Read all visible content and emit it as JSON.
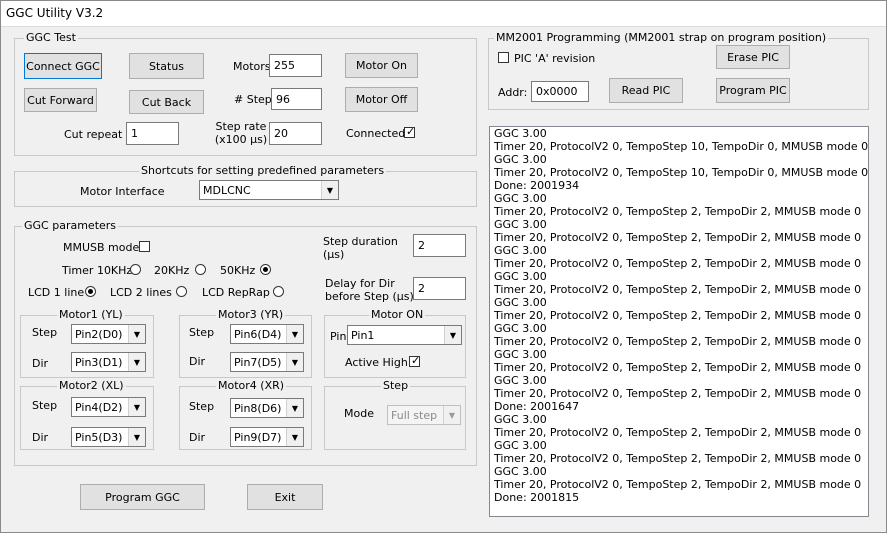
{
  "window": {
    "title": "GGC Utility V3.2"
  },
  "ggc_test": {
    "label": "GGC Test",
    "connect_ggc": "Connect GGC",
    "status": "Status",
    "cut_forward": "Cut Forward",
    "cut_back": "Cut Back",
    "cut_repeat_label": "Cut repeat",
    "cut_repeat_value": "1",
    "motors_label": "Motors",
    "motors_value": "255",
    "step_label": "# Step",
    "step_value": "96",
    "step_rate_label_1": "Step rate",
    "step_rate_label_2": "(x100 µs)",
    "step_rate_value": "20",
    "motor_on": "Motor On",
    "motor_off": "Motor Off",
    "connected_label": "Connected",
    "connected_checked": true
  },
  "shortcuts": {
    "label": "Shortcuts for setting predefined parameters",
    "motor_interface_label": "Motor Interface",
    "motor_interface_value": "MDLCNC"
  },
  "ggc_params": {
    "label": "GGC parameters",
    "mmusb_label": "MMUSB mode",
    "mmusb_checked": false,
    "timer_label": "Timer 10KHz",
    "timer_20": "20KHz",
    "timer_50": "50KHz",
    "timer_selected": "50KHz",
    "lcd_1": "LCD 1 line",
    "lcd_2": "LCD 2 lines",
    "lcd_reprap": "LCD RepRap",
    "lcd_selected": "LCD 1 line",
    "step_duration_label_1": "Step duration",
    "step_duration_label_2": "(µs)",
    "step_duration_value": "2",
    "delay_label_1": "Delay for Dir",
    "delay_label_2": "before Step (µs)",
    "delay_value": "2",
    "step_label": "Step",
    "dir_label": "Dir",
    "motor1": {
      "label": "Motor1 (YL)",
      "step": "Pin2(D0)",
      "dir": "Pin3(D1)"
    },
    "motor2": {
      "label": "Motor2 (XL)",
      "step": "Pin4(D2)",
      "dir": "Pin5(D3)"
    },
    "motor3": {
      "label": "Motor3 (YR)",
      "step": "Pin6(D4)",
      "dir": "Pin7(D5)"
    },
    "motor4": {
      "label": "Motor4 (XR)",
      "step": "Pin8(D6)",
      "dir": "Pin9(D7)"
    },
    "motor_on": {
      "label": "Motor ON",
      "pin_label": "Pin",
      "pin_value": "Pin1",
      "active_high_label": "Active High",
      "active_high_checked": true
    },
    "step_group": {
      "label": "Step",
      "mode_label": "Mode",
      "mode_value": "Full step"
    }
  },
  "buttons": {
    "program_ggc": "Program GGC",
    "exit": "Exit"
  },
  "mm2001": {
    "label": "MM2001 Programming (MM2001 strap on program position)",
    "pic_a_label": "PIC 'A' revision",
    "pic_a_checked": false,
    "erase_pic": "Erase PIC",
    "addr_label": "Addr:",
    "addr_value": "0x0000",
    "read_pic": "Read PIC",
    "program_pic": "Program PIC"
  },
  "log": [
    "GGC 3.00",
    "Timer 20, ProtocolV2 0, TempoStep 10, TempoDir 0, MMUSB mode 0",
    "GGC 3.00",
    "Timer 20, ProtocolV2 0, TempoStep 10, TempoDir 0, MMUSB mode 0",
    "Done: 2001934",
    "GGC 3.00",
    "Timer 20, ProtocolV2 0, TempoStep 2, TempoDir 2, MMUSB mode 0",
    "GGC 3.00",
    "Timer 20, ProtocolV2 0, TempoStep 2, TempoDir 2, MMUSB mode 0",
    "GGC 3.00",
    "Timer 20, ProtocolV2 0, TempoStep 2, TempoDir 2, MMUSB mode 0",
    "GGC 3.00",
    "Timer 20, ProtocolV2 0, TempoStep 2, TempoDir 2, MMUSB mode 0",
    "GGC 3.00",
    "Timer 20, ProtocolV2 0, TempoStep 2, TempoDir 2, MMUSB mode 0",
    "GGC 3.00",
    "Timer 20, ProtocolV2 0, TempoStep 2, TempoDir 2, MMUSB mode 0",
    "GGC 3.00",
    "Timer 20, ProtocolV2 0, TempoStep 2, TempoDir 2, MMUSB mode 0",
    "GGC 3.00",
    "Timer 20, ProtocolV2 0, TempoStep 2, TempoDir 2, MMUSB mode 0",
    "Done: 2001647",
    "GGC 3.00",
    "Timer 20, ProtocolV2 0, TempoStep 2, TempoDir 2, MMUSB mode 0",
    "GGC 3.00",
    "Timer 20, ProtocolV2 0, TempoStep 2, TempoDir 2, MMUSB mode 0",
    "GGC 3.00",
    "Timer 20, ProtocolV2 0, TempoStep 2, TempoDir 2, MMUSB mode 0",
    "Done: 2001815"
  ]
}
